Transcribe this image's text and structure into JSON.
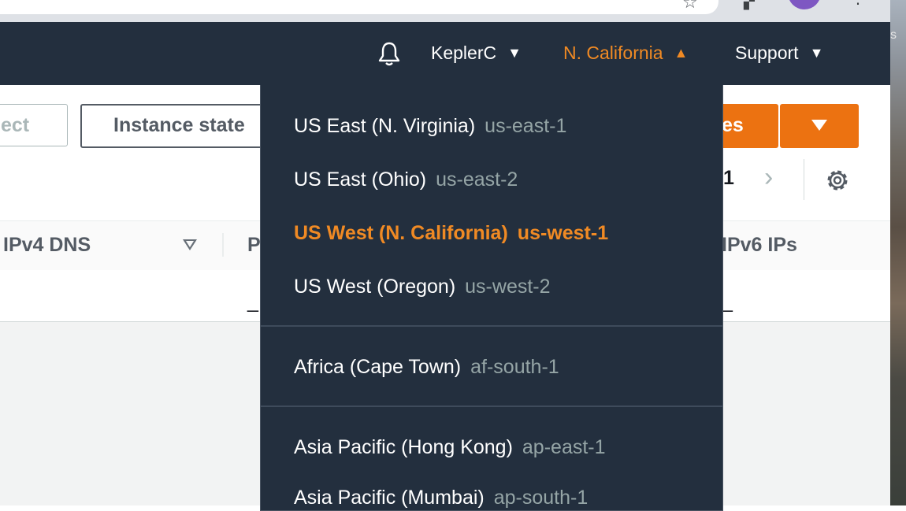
{
  "browser": {
    "star_icon": "star-icon",
    "extensions_icon": "puzzle-icon",
    "menu_icon": "kebab-icon",
    "profile_color": "#7e57c2"
  },
  "header": {
    "account_label": "KeplerC",
    "region_label": "N. California",
    "support_label": "Support",
    "accent_color": "#f08a24",
    "background_color": "#232f3e"
  },
  "background_page": {
    "filter_placeholder_fragment": "ect",
    "instance_state_label": "Instance state",
    "launch_button_fragment": "es",
    "pagination_current": "1",
    "columns": [
      {
        "label": "IPv4 DNS"
      },
      {
        "label": "P"
      },
      {
        "label": "IPv6 IPs"
      }
    ],
    "row_values": [
      "_",
      "_"
    ]
  },
  "region_menu": {
    "groups": [
      {
        "items": [
          {
            "name": "US East (N. Virginia)",
            "code": "us-east-1",
            "selected": false
          },
          {
            "name": "US East (Ohio)",
            "code": "us-east-2",
            "selected": false
          },
          {
            "name": "US West (N. California)",
            "code": "us-west-1",
            "selected": true
          },
          {
            "name": "US West (Oregon)",
            "code": "us-west-2",
            "selected": false
          }
        ]
      },
      {
        "items": [
          {
            "name": "Africa (Cape Town)",
            "code": "af-south-1",
            "selected": false
          }
        ]
      },
      {
        "items": [
          {
            "name": "Asia Pacific (Hong Kong)",
            "code": "ap-east-1",
            "selected": false
          },
          {
            "name": "Asia Pacific (Mumbai)",
            "code": "ap-south-1",
            "selected": false
          }
        ]
      }
    ]
  },
  "wallpaper_text": "s"
}
